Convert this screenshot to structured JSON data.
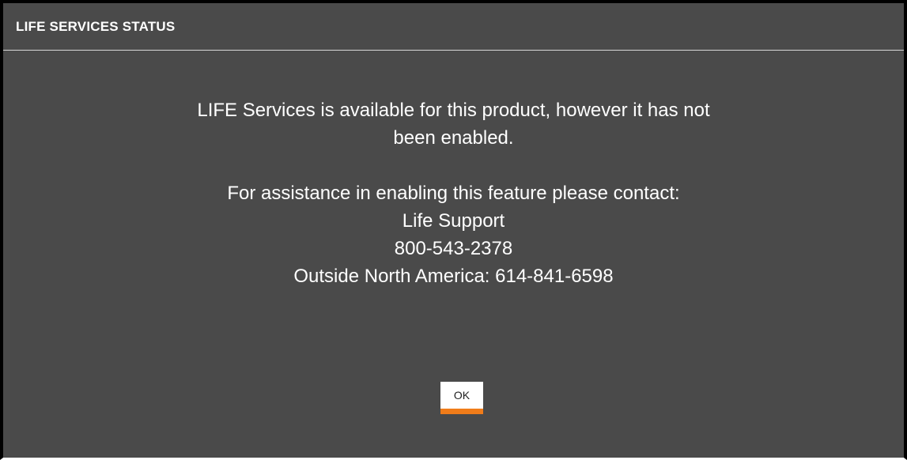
{
  "dialog": {
    "title": "LIFE SERVICES STATUS",
    "message_lines": [
      "LIFE Services is available for this product, however it has not",
      "been enabled.",
      "",
      "For assistance in enabling this feature please contact:",
      "Life Support",
      "800-543-2378",
      "Outside North America: 614-841-6598"
    ],
    "ok_label": "OK"
  },
  "colors": {
    "background": "#4a4a4a",
    "text": "#ffffff",
    "accent": "#f07c1a"
  }
}
